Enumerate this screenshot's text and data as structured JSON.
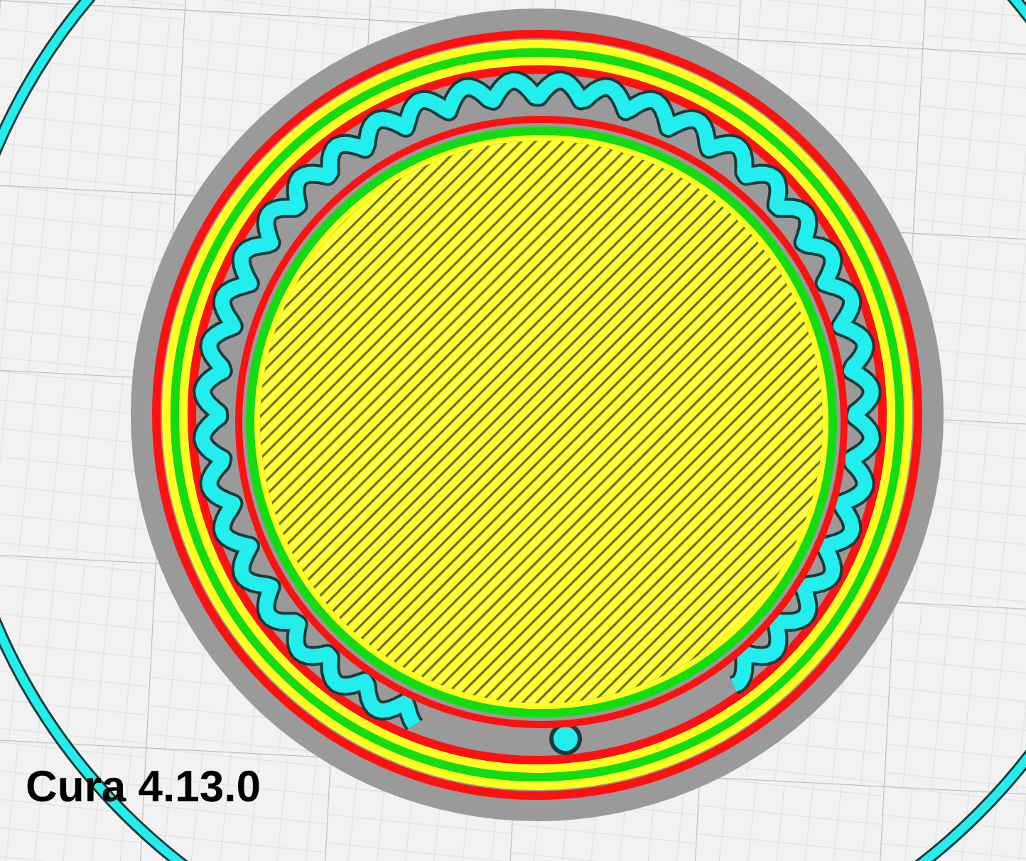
{
  "caption": "Cura 4.13.0"
}
